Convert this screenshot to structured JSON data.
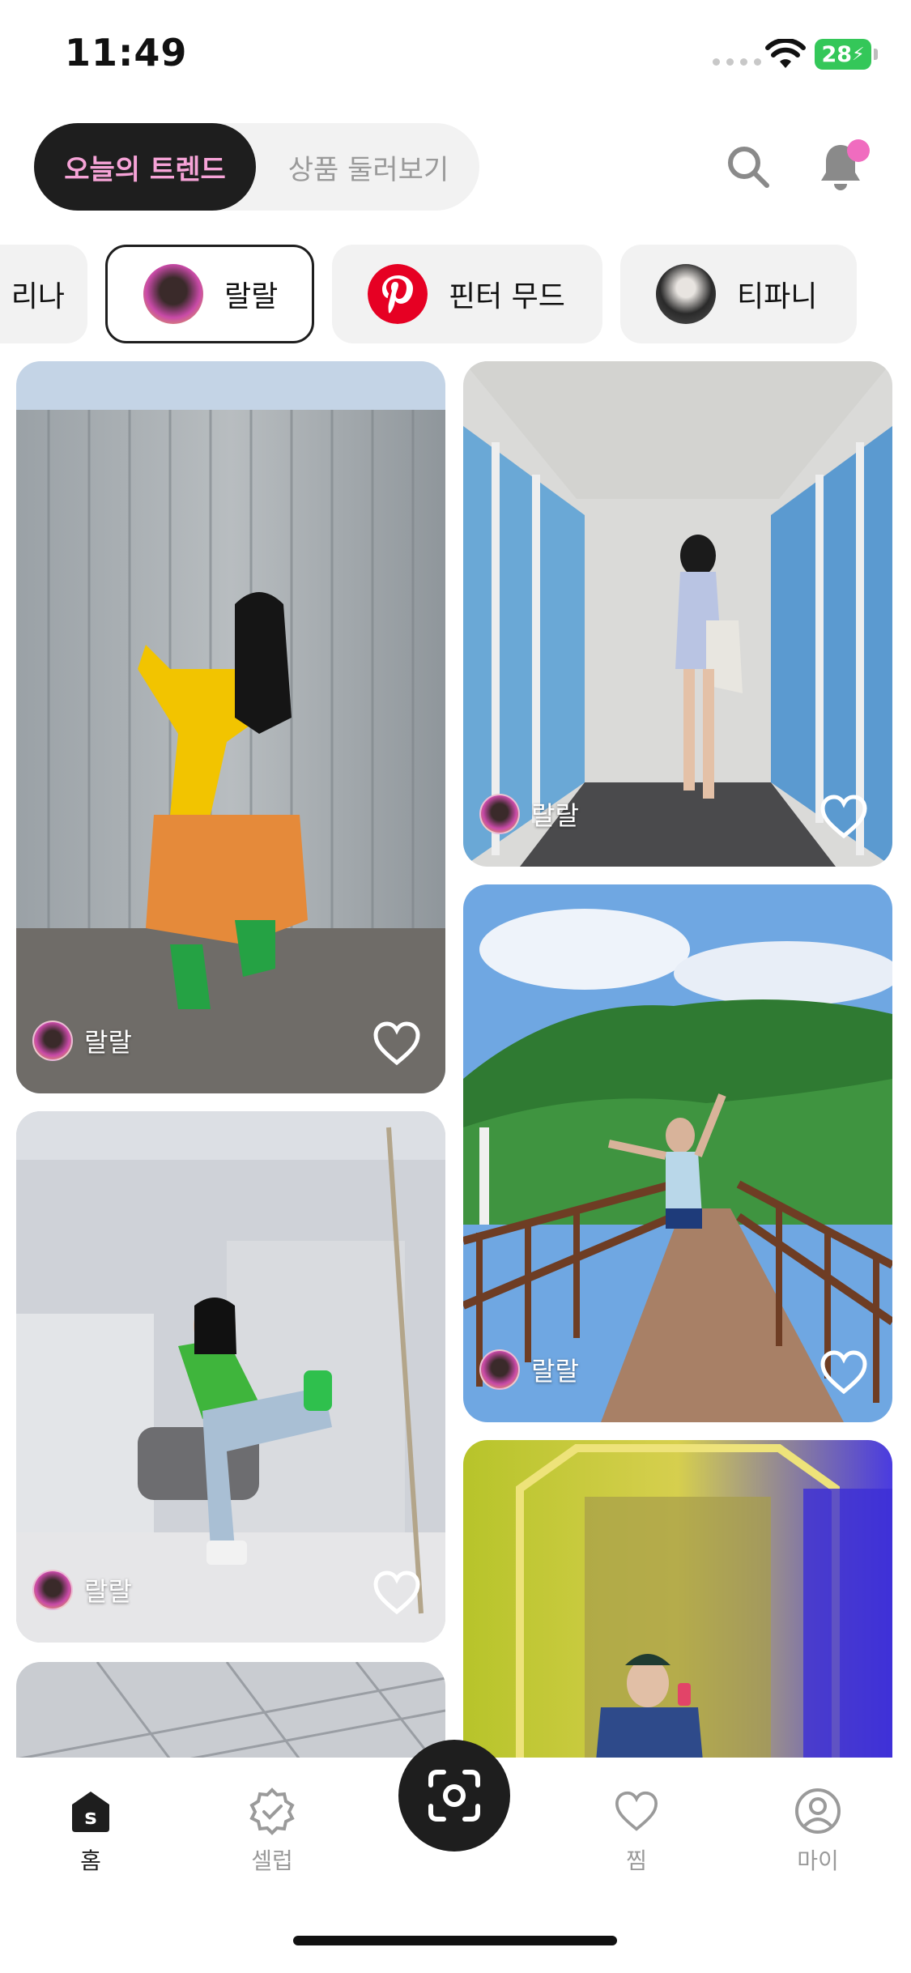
{
  "status": {
    "time": "11:49",
    "battery": "28"
  },
  "header": {
    "tabs": [
      {
        "label": "오늘의 트렌드",
        "active": true
      },
      {
        "label": "상품 둘러보기",
        "active": false
      }
    ],
    "search_icon": "search-icon",
    "bell_icon": "bell-icon",
    "accent": "#f06cbf"
  },
  "chips": [
    {
      "label": "리나",
      "selected": false
    },
    {
      "label": "랄랄",
      "selected": true
    },
    {
      "label": "핀터 무드",
      "selected": false
    },
    {
      "label": "티파니",
      "selected": false
    }
  ],
  "feed": [
    {
      "author": "랄랄",
      "liked": false
    },
    {
      "author": "랄랄",
      "liked": false
    },
    {
      "author": "랄랄",
      "liked": false
    },
    {
      "author": "랄랄",
      "liked": false
    }
  ],
  "nav": [
    {
      "label": "홈",
      "icon": "home-icon",
      "active": true
    },
    {
      "label": "셀럽",
      "icon": "verified-badge-icon",
      "active": false
    },
    {
      "label": "",
      "icon": "scan-icon",
      "active": false
    },
    {
      "label": "찜",
      "icon": "heart-icon",
      "active": false
    },
    {
      "label": "마이",
      "icon": "profile-icon",
      "active": false
    }
  ]
}
